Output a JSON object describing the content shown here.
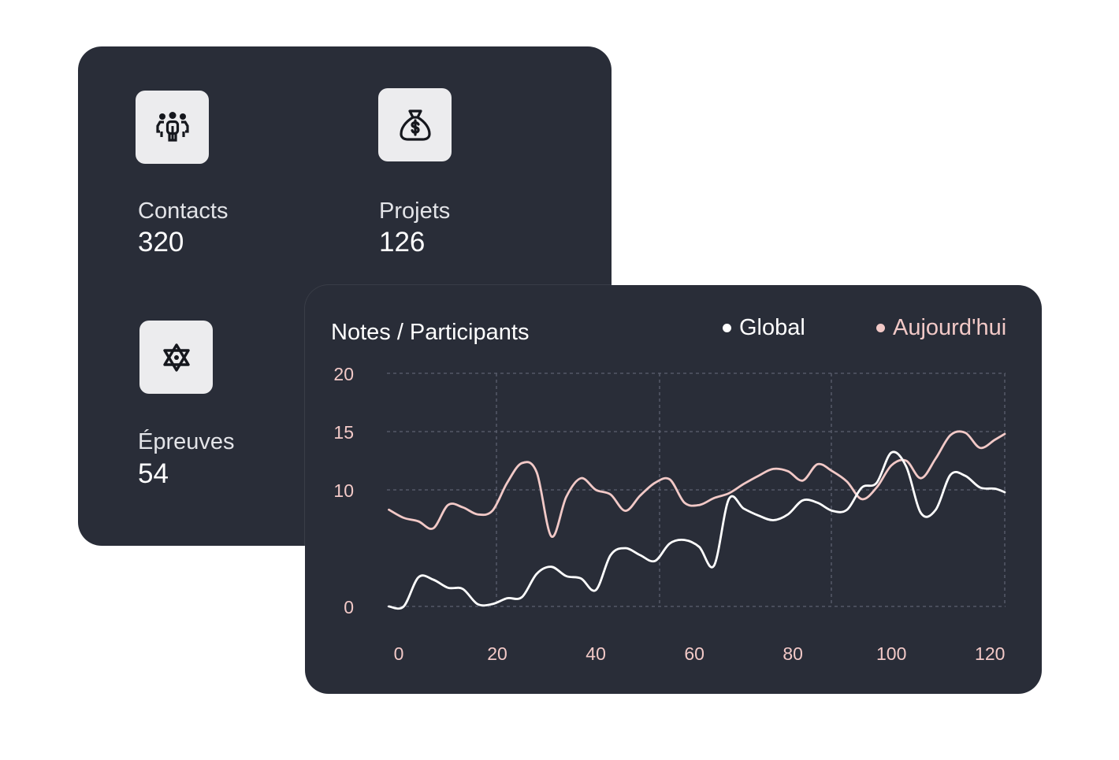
{
  "stats": [
    {
      "label": "Contacts",
      "value": "320",
      "icon": "users-group-icon"
    },
    {
      "label": "Projets",
      "value": "126",
      "icon": "money-bag-icon"
    },
    {
      "label": "Épreuves",
      "value": "54",
      "icon": "star-of-david-icon"
    }
  ],
  "colors": {
    "card_bg": "#292d38",
    "icon_bg": "#ececee",
    "global": "#ffffff",
    "today": "#f2c9c7",
    "grid": "#5d6170"
  },
  "chart_data": {
    "type": "line",
    "title": "Notes / Participants",
    "legend_position": "top-right",
    "grid": true,
    "xlim": [
      0,
      123
    ],
    "ylim": [
      0,
      20
    ],
    "x_ticks": [
      "0",
      "20",
      "40",
      "60",
      "80",
      "100",
      "120"
    ],
    "y_ticks": [
      "20",
      "15",
      "10",
      "0"
    ],
    "series": [
      {
        "name": "Global",
        "color": "#ffffff",
        "x": [
          -2,
          1,
          4,
          7,
          10,
          13,
          16,
          19,
          22,
          25,
          28,
          31,
          34,
          37,
          40,
          43,
          46,
          49,
          52,
          55,
          58,
          61,
          64,
          67,
          70,
          73,
          76,
          79,
          82,
          85,
          88,
          91,
          94,
          97,
          100,
          103,
          106,
          109,
          112,
          115,
          118,
          121,
          123
        ],
        "y": [
          0,
          0,
          2.5,
          2.3,
          1.6,
          1.5,
          0.2,
          0.2,
          0.7,
          0.8,
          2.8,
          3.4,
          2.6,
          2.4,
          1.4,
          4.4,
          5.0,
          4.4,
          3.9,
          5.4,
          5.7,
          5.1,
          3.5,
          9.2,
          8.4,
          7.8,
          7.4,
          7.9,
          9.1,
          8.9,
          8.2,
          8.3,
          10.2,
          10.6,
          13.2,
          12.0,
          8.0,
          8.3,
          11.3,
          11.2,
          10.2,
          10.1,
          9.8
        ]
      },
      {
        "name": "Aujourd'hui",
        "color": "#f2c9c7",
        "x": [
          -2,
          1,
          4,
          7,
          10,
          13,
          16,
          19,
          22,
          25,
          28,
          31,
          34,
          37,
          40,
          43,
          46,
          49,
          52,
          55,
          58,
          61,
          64,
          67,
          70,
          73,
          76,
          79,
          82,
          85,
          88,
          91,
          94,
          97,
          100,
          103,
          106,
          109,
          112,
          115,
          118,
          121,
          123
        ],
        "y": [
          8.3,
          7.6,
          7.3,
          6.7,
          8.7,
          8.5,
          7.9,
          8.2,
          10.6,
          12.3,
          11.5,
          6.0,
          9.4,
          11.0,
          10.0,
          9.6,
          8.2,
          9.5,
          10.6,
          10.9,
          8.9,
          8.7,
          9.3,
          9.7,
          10.5,
          11.2,
          11.8,
          11.6,
          10.8,
          12.2,
          11.6,
          10.7,
          9.2,
          10.2,
          12.1,
          12.5,
          11.0,
          12.7,
          14.7,
          14.9,
          13.6,
          14.3,
          14.8
        ]
      }
    ]
  }
}
